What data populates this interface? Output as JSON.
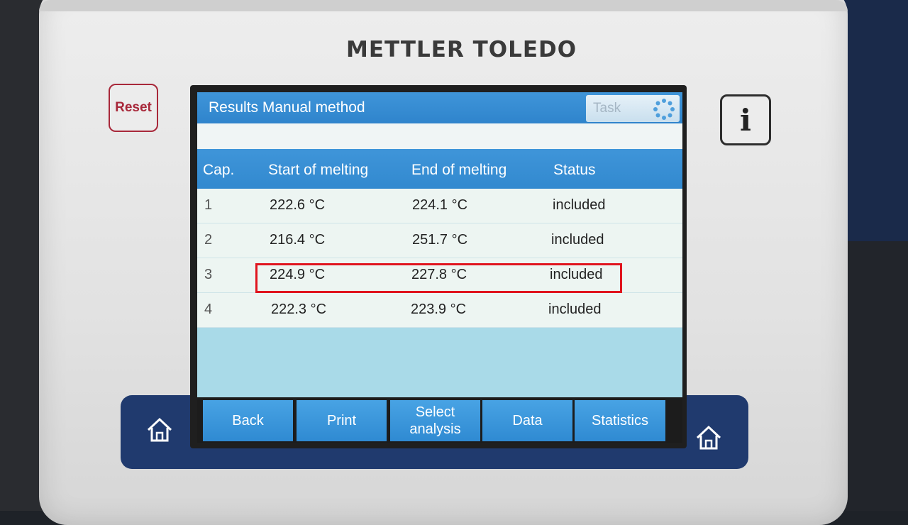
{
  "device": {
    "brand": "METTLER TOLEDO",
    "reset_label": "Reset",
    "info_label": "i"
  },
  "screen": {
    "title": "Results Manual method",
    "task_label": "Task",
    "columns": [
      "Cap.",
      "Start of melting",
      "End of melting",
      "Status"
    ],
    "rows": [
      {
        "cap": "1",
        "start": "222.6 °C",
        "end": "224.1 °C",
        "status": "included"
      },
      {
        "cap": "2",
        "start": "216.4 °C",
        "end": "251.7 °C",
        "status": "included"
      },
      {
        "cap": "3",
        "start": "224.9 °C",
        "end": "227.8 °C",
        "status": "included"
      },
      {
        "cap": "4",
        "start": "222.3 °C",
        "end": "223.9 °C",
        "status": "included"
      }
    ],
    "buttons": {
      "back": "Back",
      "print": "Print",
      "select_line1": "Select",
      "select_line2": "analysis",
      "data": "Data",
      "statistics": "Statistics"
    }
  },
  "colors": {
    "accent_blue": "#3289cf",
    "highlight_red": "#e0141e",
    "reset_red": "#a8283a"
  },
  "icons": [
    "home-icon",
    "spinner-icon",
    "info-icon"
  ]
}
